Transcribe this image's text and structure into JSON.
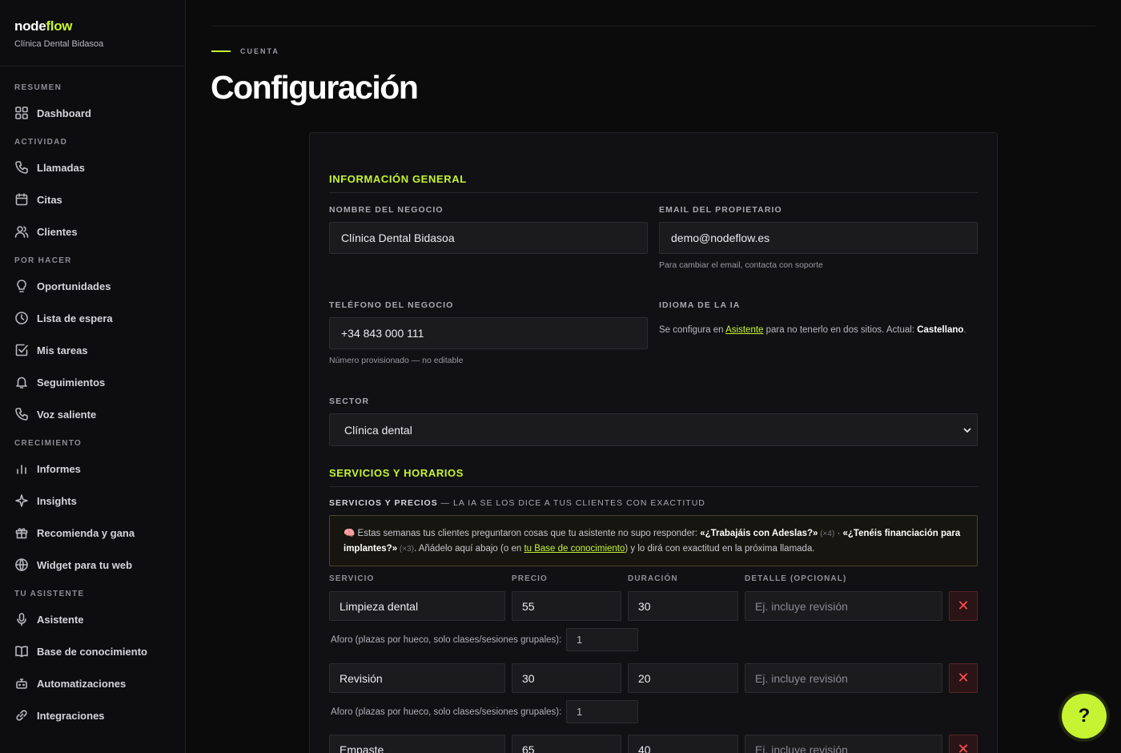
{
  "brand": {
    "name_part1": "node",
    "name_part2": "flow",
    "subtitle": "Clínica Dental Bidasoa"
  },
  "sidebar": {
    "sections": {
      "resumen": "RESUMEN",
      "actividad": "ACTIVIDAD",
      "por_hacer": "POR HACER",
      "crecimiento": "CRECIMIENTO",
      "tu_asistente": "TU ASISTENTE"
    },
    "items": {
      "dashboard": "Dashboard",
      "llamadas": "Llamadas",
      "citas": "Citas",
      "clientes": "Clientes",
      "oportunidades": "Oportunidades",
      "lista_espera": "Lista de espera",
      "mis_tareas": "Mis tareas",
      "seguimientos": "Seguimientos",
      "voz_saliente": "Voz saliente",
      "informes": "Informes",
      "insights": "Insights",
      "recomienda": "Recomienda y gana",
      "widget": "Widget para tu web",
      "asistente": "Asistente",
      "base_conocimiento": "Base de conocimiento",
      "automatizaciones": "Automatizaciones",
      "integraciones": "Integraciones"
    }
  },
  "page": {
    "eyebrow": "CUENTA",
    "title": "Configuración"
  },
  "general": {
    "heading": "INFORMACIÓN GENERAL",
    "business_name_label": "NOMBRE DEL NEGOCIO",
    "business_name_value": "Clínica Dental Bidasoa",
    "owner_email_label": "EMAIL DEL PROPIETARIO",
    "owner_email_value": "demo@nodeflow.es",
    "owner_email_hint": "Para cambiar el email, contacta con soporte",
    "phone_label": "TELÉFONO DEL NEGOCIO",
    "phone_value": "+34 843 000 111",
    "phone_hint": "Número provisionado — no editable",
    "ia_lang_label": "IDIOMA DE LA IA",
    "ia_lang_text1": "Se configura en ",
    "ia_lang_link": "Asistente",
    "ia_lang_text2": " para no tenerlo en dos sitios. Actual: ",
    "ia_lang_current": "Castellano",
    "ia_lang_text3": ".",
    "sector_label": "SECTOR",
    "sector_value": "Clínica dental"
  },
  "services": {
    "heading": "SERVICIOS Y HORARIOS",
    "sub_bold": "SERVICIOS Y PRECIOS",
    "sub_rest": " — LA IA SE LOS DICE A TUS CLIENTES CON EXACTITUD",
    "notice": {
      "emoji": "🧠",
      "t1": " Estas semanas tus clientes preguntaron cosas que tu asistente no supo responder: ",
      "q1": "«¿Trabajáis con Adeslas?»",
      "c1": " (×4)",
      "sep": " · ",
      "q2": "«¿Tenéis financiación para implantes?»",
      "c2": " (×3)",
      "t2": ". Añádelo aquí abajo (o en ",
      "link": "tu Base de conocimiento",
      "t3": ") y lo dirá con exactitud en la próxima llamada."
    },
    "columns": {
      "service": "SERVICIO",
      "price": "PRECIO",
      "duration": "DURACIÓN",
      "detail": "DETALLE (OPCIONAL)"
    },
    "detail_placeholder": "Ej. incluye revisión",
    "aforo_label": "Aforo (plazas por hueco, solo clases/sesiones grupales):",
    "rows": [
      {
        "name": "Limpieza dental",
        "price": "55",
        "duration": "30",
        "aforo": "1"
      },
      {
        "name": "Revisión",
        "price": "30",
        "duration": "20",
        "aforo": "1"
      },
      {
        "name": "Empaste",
        "price": "65",
        "duration": "40"
      }
    ],
    "delete_symbol": "✕"
  },
  "help_button": "?",
  "colors": {
    "accent": "#c6f432",
    "danger": "#ff4d55",
    "background": "#0b0b0c"
  }
}
